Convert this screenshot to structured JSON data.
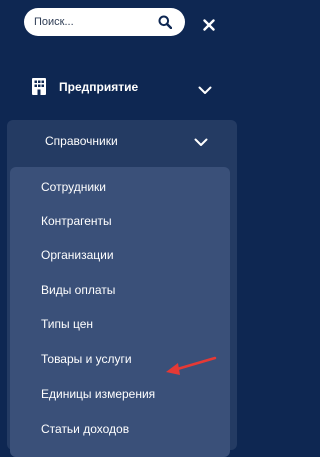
{
  "search": {
    "placeholder": "Поиск..."
  },
  "icons": {
    "search": "search-icon",
    "close": "close-icon",
    "building": "building-icon",
    "chevron": "chevron-down-icon"
  },
  "section": {
    "title": "Предприятие"
  },
  "subsection": {
    "title": "Справочники",
    "items": [
      {
        "label": "Сотрудники"
      },
      {
        "label": "Контрагенты"
      },
      {
        "label": "Организации"
      },
      {
        "label": "Виды оплаты"
      },
      {
        "label": "Типы цен"
      },
      {
        "label": "Товары и услуги"
      },
      {
        "label": "Единицы измерения"
      },
      {
        "label": "Статьи доходов"
      }
    ]
  },
  "colors": {
    "background": "#0e2752",
    "subpanel": "#243b63",
    "list_panel": "#3a5079",
    "annotation_arrow": "#e53935"
  }
}
